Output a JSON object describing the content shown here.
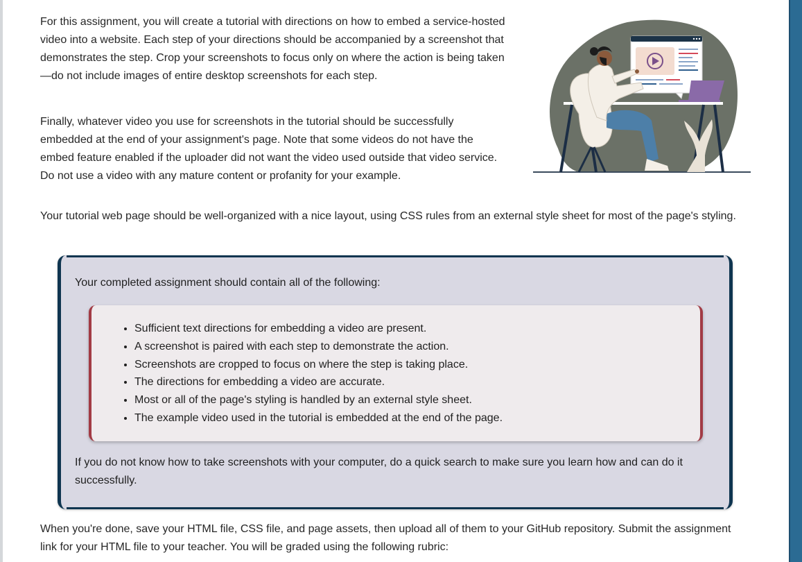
{
  "intro": {
    "paragraph_1": "For this assignment, you will create a tutorial with directions on how to embed a service-hosted video into a website. Each step of your directions should be accompanied by a screenshot that demonstrates the step. Crop your screenshots to focus only on where the action is being taken—do not include images of entire desktop screenshots for each step.",
    "paragraph_2": "Finally, whatever video you use for screenshots in the tutorial should be successfully embedded at the end of your assignment's page. Note that some videos do not have the embed feature enabled if the uploader did not want the video used outside that video service. Do not use a video with any mature content or profanity for your example."
  },
  "layout_paragraph": "Your tutorial web page should be well-organized with a nice layout, using CSS rules from an external style sheet for most of the page's styling.",
  "requirements_box": {
    "intro": "Your completed assignment should contain all of the following:",
    "items": [
      "Sufficient text directions for embedding a video are present.",
      "A screenshot is paired with each step to demonstrate the action.",
      "Screenshots are cropped to focus on where the step is taking place.",
      "The directions for embedding a video are accurate.",
      "Most or all of the page's styling is handled by an external style sheet.",
      "The example video used in the tutorial is embedded at the end of the page."
    ],
    "footer": "If you do not know how to take screenshots with your computer, do a quick search to make sure you learn how and can do it successfully."
  },
  "submission_paragraph": "When you're done, save your HTML file, CSS file, and page assets, then upload all of them to your GitHub repository. Submit the assignment link for your HTML file to your teacher. You will be graded using the following rubric:",
  "colors": {
    "outer_box_bg": "#d9d8e3",
    "outer_box_border": "#0f3550",
    "inner_box_bg": "#efebed",
    "inner_box_border": "#a23b45",
    "right_strip": "#2b6b93"
  },
  "illustration": {
    "icon": "person-watching-video-illustration"
  }
}
